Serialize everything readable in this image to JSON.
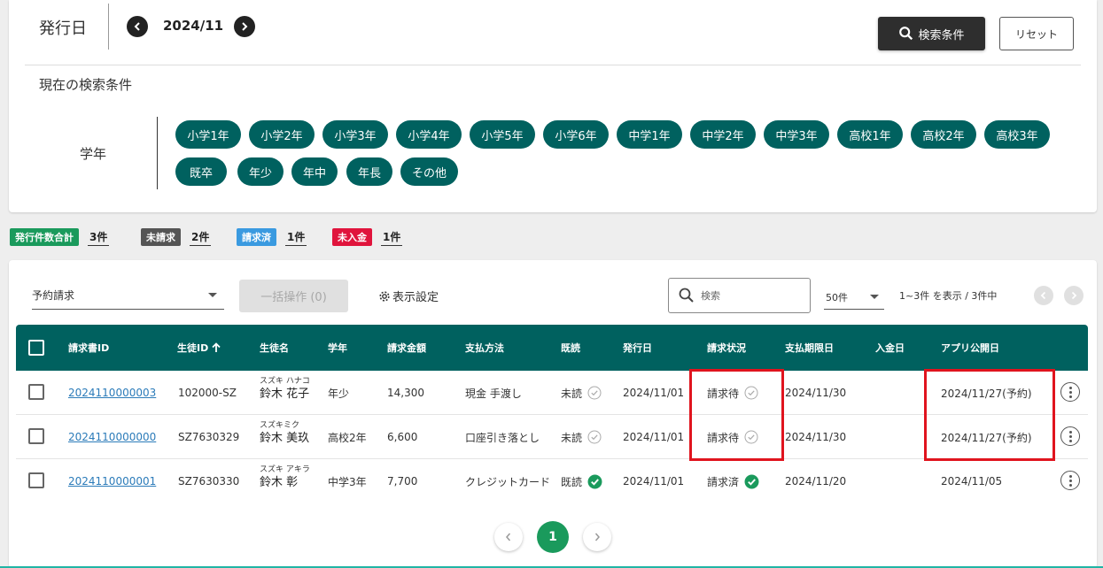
{
  "header": {
    "issue_date_label": "発行日",
    "month": "2024/11",
    "search_button": "検索条件",
    "reset_button": "リセット",
    "current_conditions": "現在の検索条件",
    "grade_label": "学年",
    "grade_chips": [
      "小学1年",
      "小学2年",
      "小学3年",
      "小学4年",
      "小学5年",
      "小学6年",
      "中学1年",
      "中学2年",
      "中学3年",
      "高校1年",
      "高校2年",
      "高校3年",
      "既卒",
      "年少",
      "年中",
      "年長",
      "その他"
    ]
  },
  "summary": {
    "total_label": "発行件数合計",
    "total_count": "3件",
    "total_color": "#1a9a5c",
    "unbilled_label": "未請求",
    "unbilled_count": "2件",
    "unbilled_color": "#555555",
    "billed_label": "請求済",
    "billed_count": "1件",
    "billed_color": "#3a9ae0",
    "unpaid_label": "未入金",
    "unpaid_count": "1件",
    "unpaid_color": "#e0143c"
  },
  "toolbar": {
    "billing_type": "予約請求",
    "bulk_button": "一括操作 (0)",
    "display_settings": "表示設定",
    "search_placeholder": "検索",
    "per_page": "50件",
    "range": "1~3件 を表示 / 3件中"
  },
  "table": {
    "headers": {
      "invoice_id": "請求書ID",
      "student_id": "生徒ID",
      "student_name": "生徒名",
      "grade": "学年",
      "amount": "請求金額",
      "payment_method": "支払方法",
      "read": "既読",
      "issue_date": "発行日",
      "billing_status": "請求状況",
      "due_date": "支払期限日",
      "payment_date": "入金日",
      "app_publish_date": "アプリ公開日"
    },
    "rows": [
      {
        "invoice_id": "2024110000003",
        "student_id": "102000-SZ",
        "kana": "スズキ ハナコ",
        "name": "鈴木 花子",
        "grade": "年少",
        "amount": "14,300",
        "payment_method": "現金 手渡し",
        "read": "未読",
        "issue_date": "2024/11/01",
        "billing_status": "請求待",
        "due_date": "2024/11/30",
        "payment_date": "",
        "app_publish_date": "2024/11/27(予約)"
      },
      {
        "invoice_id": "2024110000000",
        "student_id": "SZ7630329",
        "kana": "スズキミク",
        "name": "鈴木 美玖",
        "grade": "高校2年",
        "amount": "6,600",
        "payment_method": "口座引き落とし",
        "read": "未読",
        "issue_date": "2024/11/01",
        "billing_status": "請求待",
        "due_date": "2024/11/30",
        "payment_date": "",
        "app_publish_date": "2024/11/27(予約)"
      },
      {
        "invoice_id": "2024110000001",
        "student_id": "SZ7630330",
        "kana": "スズキ アキラ",
        "name": "鈴木 彰",
        "grade": "中学3年",
        "amount": "7,700",
        "payment_method": "クレジットカード",
        "read": "既読",
        "issue_date": "2024/11/01",
        "billing_status": "請求済",
        "due_date": "2024/11/20",
        "payment_date": "",
        "app_publish_date": "2024/11/05"
      }
    ]
  },
  "pagination": {
    "current": "1"
  },
  "colors": {
    "primary": "#00615f",
    "accent_green": "#1a9a5c",
    "highlight": "#e0141e"
  }
}
